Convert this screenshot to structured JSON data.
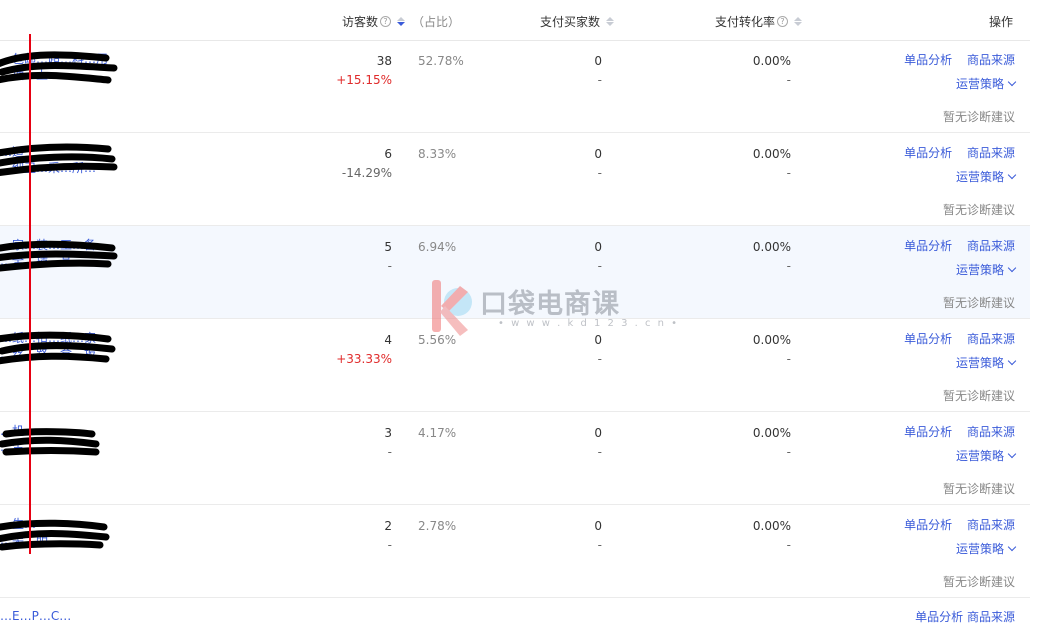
{
  "header": {
    "visitors": "访客数",
    "share": "（占比）",
    "buyers": "支付买家数",
    "conversion": "支付转化率",
    "actions": "操作"
  },
  "row_actions": {
    "analysis": "单品分析",
    "source": "商品来源",
    "strategy": "运营策略",
    "no_advice": "暂无诊断建议"
  },
  "rows": [
    {
      "title1": "…包邮…超…料…用",
      "title2": "…抽…上…",
      "visitors": "38",
      "change": "+15.15%",
      "share": "52.78%",
      "buyers": "0",
      "buyers_sub": "-",
      "conv": "0.00%",
      "conv_sub": "-"
    },
    {
      "title1": "…适",
      "title2": "…细卫…采…所…",
      "visitors": "6",
      "change": "-14.29%",
      "share": "8.33%",
      "buyers": "0",
      "buyers_sub": "-",
      "conv": "0.00%",
      "conv_sub": "-"
    },
    {
      "title1": "…家…装…工…备",
      "title2": "…全…插…品…",
      "visitors": "5",
      "change": "-",
      "share": "6.94%",
      "buyers": "0",
      "buyers_sub": "-",
      "conv": "0.00%",
      "conv_sub": "-"
    },
    {
      "title1": "…纸…扣…纸…家",
      "title2": "…丝…路…盒…扳…",
      "visitors": "4",
      "change": "+33.33%",
      "share": "5.56%",
      "buyers": "0",
      "buyers_sub": "-",
      "conv": "0.00%",
      "conv_sub": "-"
    },
    {
      "title1": "…机",
      "title2": "…生……",
      "visitors": "3",
      "change": "-",
      "share": "4.17%",
      "buyers": "0",
      "buyers_sub": "-",
      "conv": "0.00%",
      "conv_sub": "-"
    },
    {
      "title1": "…生…",
      "title2": "…装…明…",
      "visitors": "2",
      "change": "-",
      "share": "2.78%",
      "buyers": "0",
      "buyers_sub": "-",
      "conv": "0.00%",
      "conv_sub": "-"
    }
  ],
  "partial_row": {
    "title1": "…E…P…C…",
    "actions": "单品分析 商品来源"
  },
  "watermark": {
    "brand": "口袋电商课",
    "url": "• w w w . k d 1 2 3 . c n •"
  },
  "colors": {
    "link": "#3a5bd9",
    "red": "#e02b2b",
    "highlight_row": "#f4f8fe",
    "marker": "#e60012"
  }
}
